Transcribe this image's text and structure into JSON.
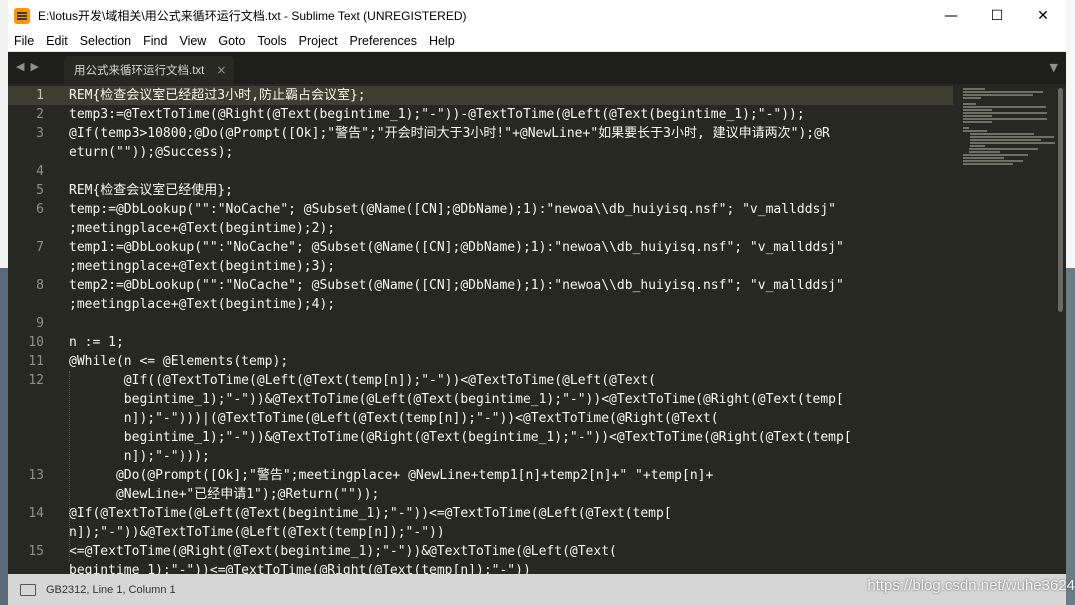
{
  "window": {
    "title": "E:\\lotus开发\\域相关\\用公式来循环运行文档.txt - Sublime Text (UNREGISTERED)",
    "controls": {
      "minimize": "—",
      "maximize": "☐",
      "close": "✕"
    }
  },
  "menu": [
    "File",
    "Edit",
    "Selection",
    "Find",
    "View",
    "Goto",
    "Tools",
    "Project",
    "Preferences",
    "Help"
  ],
  "tab": {
    "label": "用公式来循环运行文档.txt",
    "close": "×"
  },
  "tab_nav": {
    "prev": "◀",
    "next": "▶",
    "dropdown": "▼"
  },
  "line_numbers": [
    {
      "n": "1",
      "row": 0,
      "active": true
    },
    {
      "n": "2",
      "row": 1
    },
    {
      "n": "3",
      "row": 2
    },
    {
      "n": "4",
      "row": 4
    },
    {
      "n": "5",
      "row": 5
    },
    {
      "n": "6",
      "row": 6
    },
    {
      "n": "7",
      "row": 8
    },
    {
      "n": "8",
      "row": 10
    },
    {
      "n": "9",
      "row": 12
    },
    {
      "n": "10",
      "row": 13
    },
    {
      "n": "11",
      "row": 14
    },
    {
      "n": "12",
      "row": 15
    },
    {
      "n": "13",
      "row": 20
    },
    {
      "n": "14",
      "row": 22
    },
    {
      "n": "15",
      "row": 24
    }
  ],
  "code_lines": [
    "REM{检查会议室已经超过3小时,防止霸占会议室};",
    "temp3:=@TextToTime(@Right(@Text(begintime_1);\"-\"))-@TextToTime(@Left(@Text(begintime_1);\"-\"));",
    "@If(temp3>10800;@Do(@Prompt([Ok];\"警告\";\"开会时间大于3小时!\"+@NewLine+\"如果要长于3小时, 建议申请两次\");@R",
    "eturn(\"\"));@Success);",
    "",
    "REM{检查会议室已经使用};",
    "temp:=@DbLookup(\"\":\"NoCache\"; @Subset(@Name([CN];@DbName);1):\"newoa\\\\db_huiyisq.nsf\"; \"v_mallddsj\"",
    ";meetingplace+@Text(begintime);2);",
    "temp1:=@DbLookup(\"\":\"NoCache\"; @Subset(@Name([CN];@DbName);1):\"newoa\\\\db_huiyisq.nsf\"; \"v_mallddsj\"",
    ";meetingplace+@Text(begintime);3);",
    "temp2:=@DbLookup(\"\":\"NoCache\"; @Subset(@Name([CN];@DbName);1):\"newoa\\\\db_huiyisq.nsf\"; \"v_mallddsj\"",
    ";meetingplace+@Text(begintime);4);",
    "",
    "n := 1;",
    "@While(n <= @Elements(temp);",
    "       @If((@TextToTime(@Left(@Text(temp[n]);\"-\"))<@TextToTime(@Left(@Text(",
    "       begintime_1);\"-\"))&@TextToTime(@Left(@Text(begintime_1);\"-\"))<@TextToTime(@Right(@Text(temp[",
    "       n]);\"-\")))|(@TextToTime(@Left(@Text(temp[n]);\"-\"))<@TextToTime(@Right(@Text(",
    "       begintime_1);\"-\"))&@TextToTime(@Right(@Text(begintime_1);\"-\"))<@TextToTime(@Right(@Text(temp[",
    "       n]);\"-\")));",
    "      @Do(@Prompt([Ok];\"警告\";meetingplace+ @NewLine+temp1[n]+temp2[n]+\" \"+temp[n]+",
    "      @NewLine+\"已经申请1\");@Return(\"\"));",
    "@If(@TextToTime(@Left(@Text(begintime_1);\"-\"))<=@TextToTime(@Left(@Text(temp[",
    "n]);\"-\"))&@TextToTime(@Left(@Text(temp[n]);\"-\"))",
    "<=@TextToTime(@Right(@Text(begintime_1);\"-\"))&@TextToTime(@Left(@Text(",
    "begintime_1);\"-\"))<=@TextToTime(@Right(@Text(temp[n]);\"-\"))"
  ],
  "status": {
    "text": "GB2312, Line 1, Column 1"
  },
  "watermark": "https://blog.csdn.net/wuhe3624",
  "colors": {
    "editor_bg": "#272822",
    "text": "#f8f8f2",
    "line_number": "#90908a",
    "current_line": "#3e3d32",
    "status_bg": "#d6d6d6",
    "app_icon": "#ff9800"
  }
}
